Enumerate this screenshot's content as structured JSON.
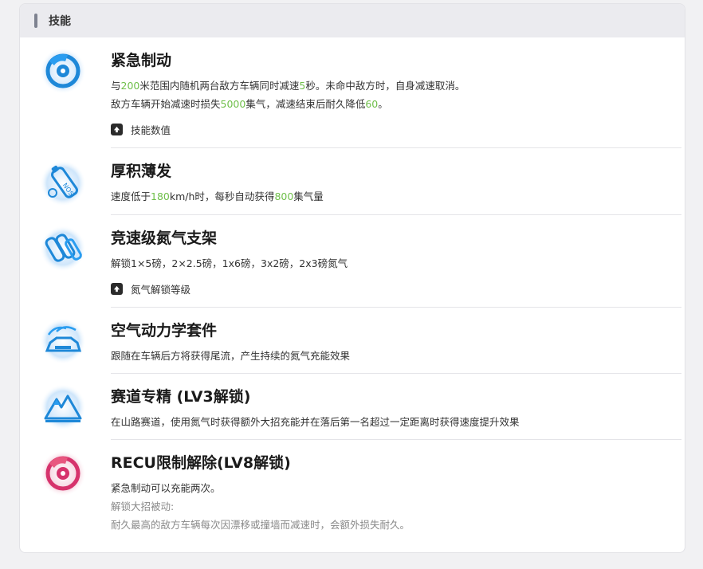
{
  "header": {
    "title": "技能"
  },
  "skills": [
    {
      "icon": "brake-disc-icon",
      "title": "紧急制动",
      "line1": {
        "p1": "与",
        "n1": "200",
        "p2": "米范围内随机两台敌方车辆同时减速",
        "n2": "5",
        "p3": "秒。未命中敌方时，自身减速取消。"
      },
      "line2": {
        "p1": "敌方车辆开始减速时损失",
        "n1": "5000",
        "p2": "集气，减速结束后耐久降低",
        "n2": "60",
        "p3": "。"
      },
      "expand": "技能数值"
    },
    {
      "icon": "nitro-bottle-icon",
      "title": "厚积薄发",
      "line1": {
        "p1": "速度低于",
        "n1": "180",
        "p2": "km/h时，每秒自动获得",
        "n2": "800",
        "p3": "集气量"
      }
    },
    {
      "icon": "nitro-rack-icon",
      "title": "竞速级氮气支架",
      "line1": "解锁1×5磅，2×2.5磅，1x6磅，3x2磅，2x3磅氮气",
      "expand": "氮气解锁等级"
    },
    {
      "icon": "aero-kit-icon",
      "title": "空气动力学套件",
      "line1": "跟随在车辆后方将获得尾流，产生持续的氮气充能效果"
    },
    {
      "icon": "mountain-icon",
      "title": "赛道专精 (LV3解锁)",
      "line1": "在山路赛道，使用氮气时获得额外大招充能并在落后第一名超过一定距离时获得速度提升效果"
    },
    {
      "icon": "brake-disc-red-icon",
      "title": "RECU限制解除(LV8解锁)",
      "line1": "紧急制动可以充能两次。",
      "line2": "解锁大招被动:",
      "line3": "耐久最高的敌方车辆每次因漂移或撞墙而减速时，会额外损失耐久。"
    }
  ],
  "colors": {
    "highlight": "#6fbf4a",
    "icon_blue": "#1e88d8",
    "icon_red": "#d6336c"
  }
}
